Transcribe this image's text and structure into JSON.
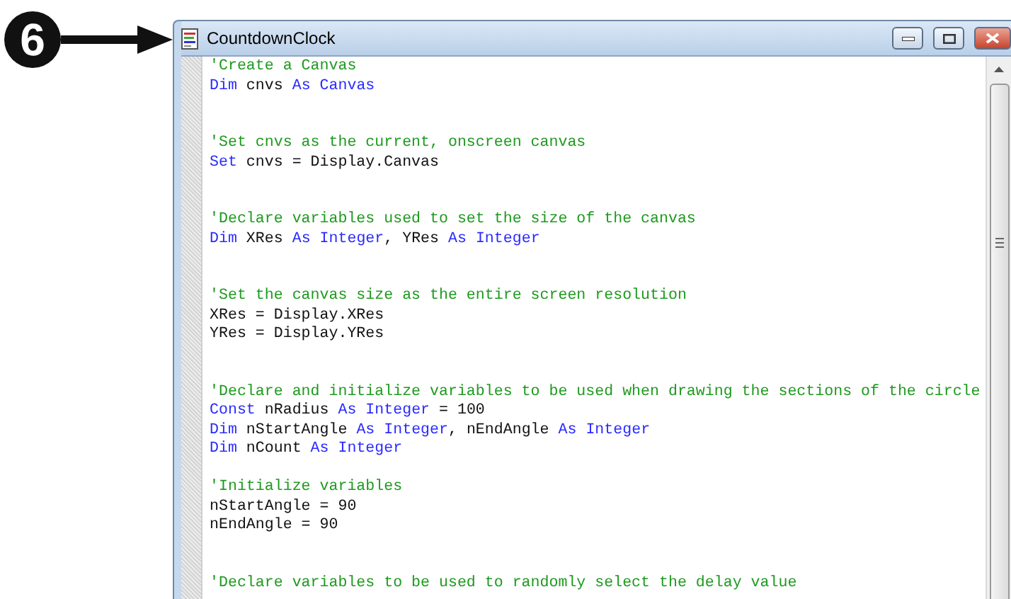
{
  "callout": {
    "number": "6"
  },
  "window": {
    "title": "CountdownClock"
  },
  "code_lines": [
    {
      "kind": "code",
      "tokens": [
        {
          "kind": "comment",
          "text": "'Create a Canvas"
        }
      ]
    },
    {
      "kind": "code",
      "tokens": [
        {
          "kind": "keyword",
          "text": "Dim"
        },
        {
          "kind": "plain",
          "text": " cnvs "
        },
        {
          "kind": "keyword",
          "text": "As Canvas"
        }
      ]
    },
    {
      "kind": "blank"
    },
    {
      "kind": "blank"
    },
    {
      "kind": "code",
      "tokens": [
        {
          "kind": "comment",
          "text": "'Set cnvs as the current, onscreen canvas"
        }
      ]
    },
    {
      "kind": "code",
      "tokens": [
        {
          "kind": "keyword",
          "text": "Set"
        },
        {
          "kind": "plain",
          "text": " cnvs = Display.Canvas"
        }
      ]
    },
    {
      "kind": "blank"
    },
    {
      "kind": "blank"
    },
    {
      "kind": "code",
      "tokens": [
        {
          "kind": "comment",
          "text": "'Declare variables used to set the size of the canvas"
        }
      ]
    },
    {
      "kind": "code",
      "tokens": [
        {
          "kind": "keyword",
          "text": "Dim"
        },
        {
          "kind": "plain",
          "text": " XRes "
        },
        {
          "kind": "keyword",
          "text": "As Integer"
        },
        {
          "kind": "plain",
          "text": ", YRes "
        },
        {
          "kind": "keyword",
          "text": "As Integer"
        }
      ]
    },
    {
      "kind": "blank"
    },
    {
      "kind": "blank"
    },
    {
      "kind": "code",
      "tokens": [
        {
          "kind": "comment",
          "text": "'Set the canvas size as the entire screen resolution"
        }
      ]
    },
    {
      "kind": "code",
      "tokens": [
        {
          "kind": "plain",
          "text": "XRes = Display.XRes"
        }
      ]
    },
    {
      "kind": "code",
      "tokens": [
        {
          "kind": "plain",
          "text": "YRes = Display.YRes"
        }
      ]
    },
    {
      "kind": "blank"
    },
    {
      "kind": "blank"
    },
    {
      "kind": "code",
      "tokens": [
        {
          "kind": "comment",
          "text": "'Declare and initialize variables to be used when drawing the sections of the circle"
        }
      ]
    },
    {
      "kind": "code",
      "tokens": [
        {
          "kind": "keyword",
          "text": "Const"
        },
        {
          "kind": "plain",
          "text": " nRadius "
        },
        {
          "kind": "keyword",
          "text": "As Integer"
        },
        {
          "kind": "plain",
          "text": " = 100"
        }
      ]
    },
    {
      "kind": "code",
      "tokens": [
        {
          "kind": "keyword",
          "text": "Dim"
        },
        {
          "kind": "plain",
          "text": " nStartAngle "
        },
        {
          "kind": "keyword",
          "text": "As Integer"
        },
        {
          "kind": "plain",
          "text": ", nEndAngle "
        },
        {
          "kind": "keyword",
          "text": "As Integer"
        }
      ]
    },
    {
      "kind": "code",
      "tokens": [
        {
          "kind": "keyword",
          "text": "Dim"
        },
        {
          "kind": "plain",
          "text": " nCount "
        },
        {
          "kind": "keyword",
          "text": "As Integer"
        }
      ]
    },
    {
      "kind": "blank"
    },
    {
      "kind": "code",
      "tokens": [
        {
          "kind": "comment",
          "text": "'Initialize variables"
        }
      ]
    },
    {
      "kind": "code",
      "tokens": [
        {
          "kind": "plain",
          "text": "nStartAngle = 90"
        }
      ]
    },
    {
      "kind": "code",
      "tokens": [
        {
          "kind": "plain",
          "text": "nEndAngle = 90"
        }
      ]
    },
    {
      "kind": "blank"
    },
    {
      "kind": "blank"
    },
    {
      "kind": "code",
      "tokens": [
        {
          "kind": "comment",
          "text": "'Declare variables to be used to randomly select the delay value"
        }
      ]
    }
  ]
}
